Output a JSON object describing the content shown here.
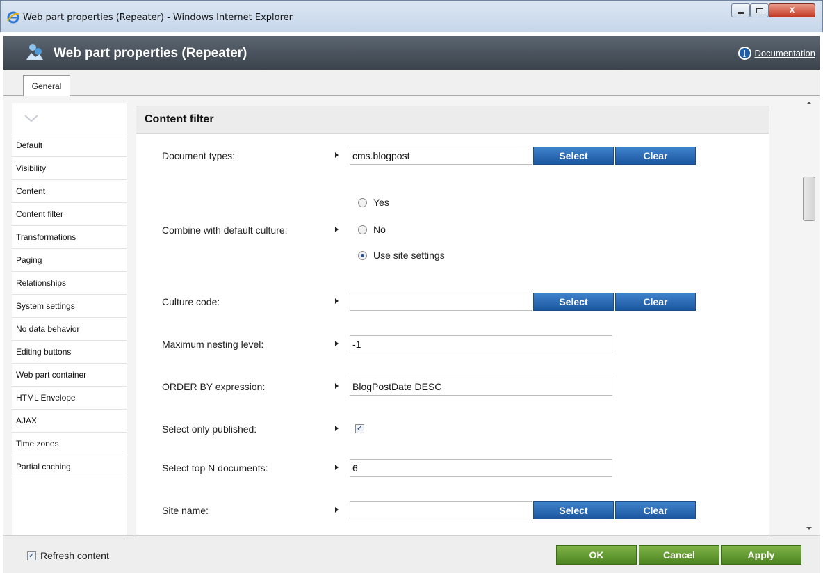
{
  "window": {
    "title": "Web part properties (Repeater) - Windows Internet Explorer",
    "close_label": "X"
  },
  "header": {
    "title": "Web part properties (Repeater)",
    "doc_link": "Documentation",
    "info_icon": "i"
  },
  "tabs": [
    {
      "label": "General"
    }
  ],
  "sidebar": {
    "items": [
      {
        "label": "Default"
      },
      {
        "label": "Visibility"
      },
      {
        "label": "Content"
      },
      {
        "label": "Content filter"
      },
      {
        "label": "Transformations"
      },
      {
        "label": "Paging"
      },
      {
        "label": "Relationships"
      },
      {
        "label": "System settings"
      },
      {
        "label": "No data behavior"
      },
      {
        "label": "Editing buttons"
      },
      {
        "label": "Web part container"
      },
      {
        "label": "HTML Envelope"
      },
      {
        "label": "AJAX"
      },
      {
        "label": "Time zones"
      },
      {
        "label": "Partial caching"
      }
    ]
  },
  "section": {
    "title": "Content filter",
    "select_label": "Select",
    "clear_label": "Clear",
    "fields": {
      "document_types": {
        "label": "Document types:",
        "value": "cms.blogpost"
      },
      "combine_culture": {
        "label": "Combine with default culture:",
        "options": [
          "Yes",
          "No",
          "Use site settings"
        ],
        "selected": "Use site settings"
      },
      "culture_code": {
        "label": "Culture code:",
        "value": ""
      },
      "max_nesting": {
        "label": "Maximum nesting level:",
        "value": "-1"
      },
      "order_by": {
        "label": "ORDER BY expression:",
        "value": "BlogPostDate DESC"
      },
      "only_published": {
        "label": "Select only published:",
        "checked": true
      },
      "top_n": {
        "label": "Select top N documents:",
        "value": "6"
      },
      "site_name": {
        "label": "Site name:",
        "value": ""
      }
    }
  },
  "footer": {
    "refresh_label": "Refresh content",
    "refresh_checked": true,
    "ok_label": "OK",
    "cancel_label": "Cancel",
    "apply_label": "Apply"
  },
  "colors": {
    "accent_blue": "#2a6bb5",
    "accent_green": "#5a9a2a",
    "header_dark": "#454d56"
  }
}
